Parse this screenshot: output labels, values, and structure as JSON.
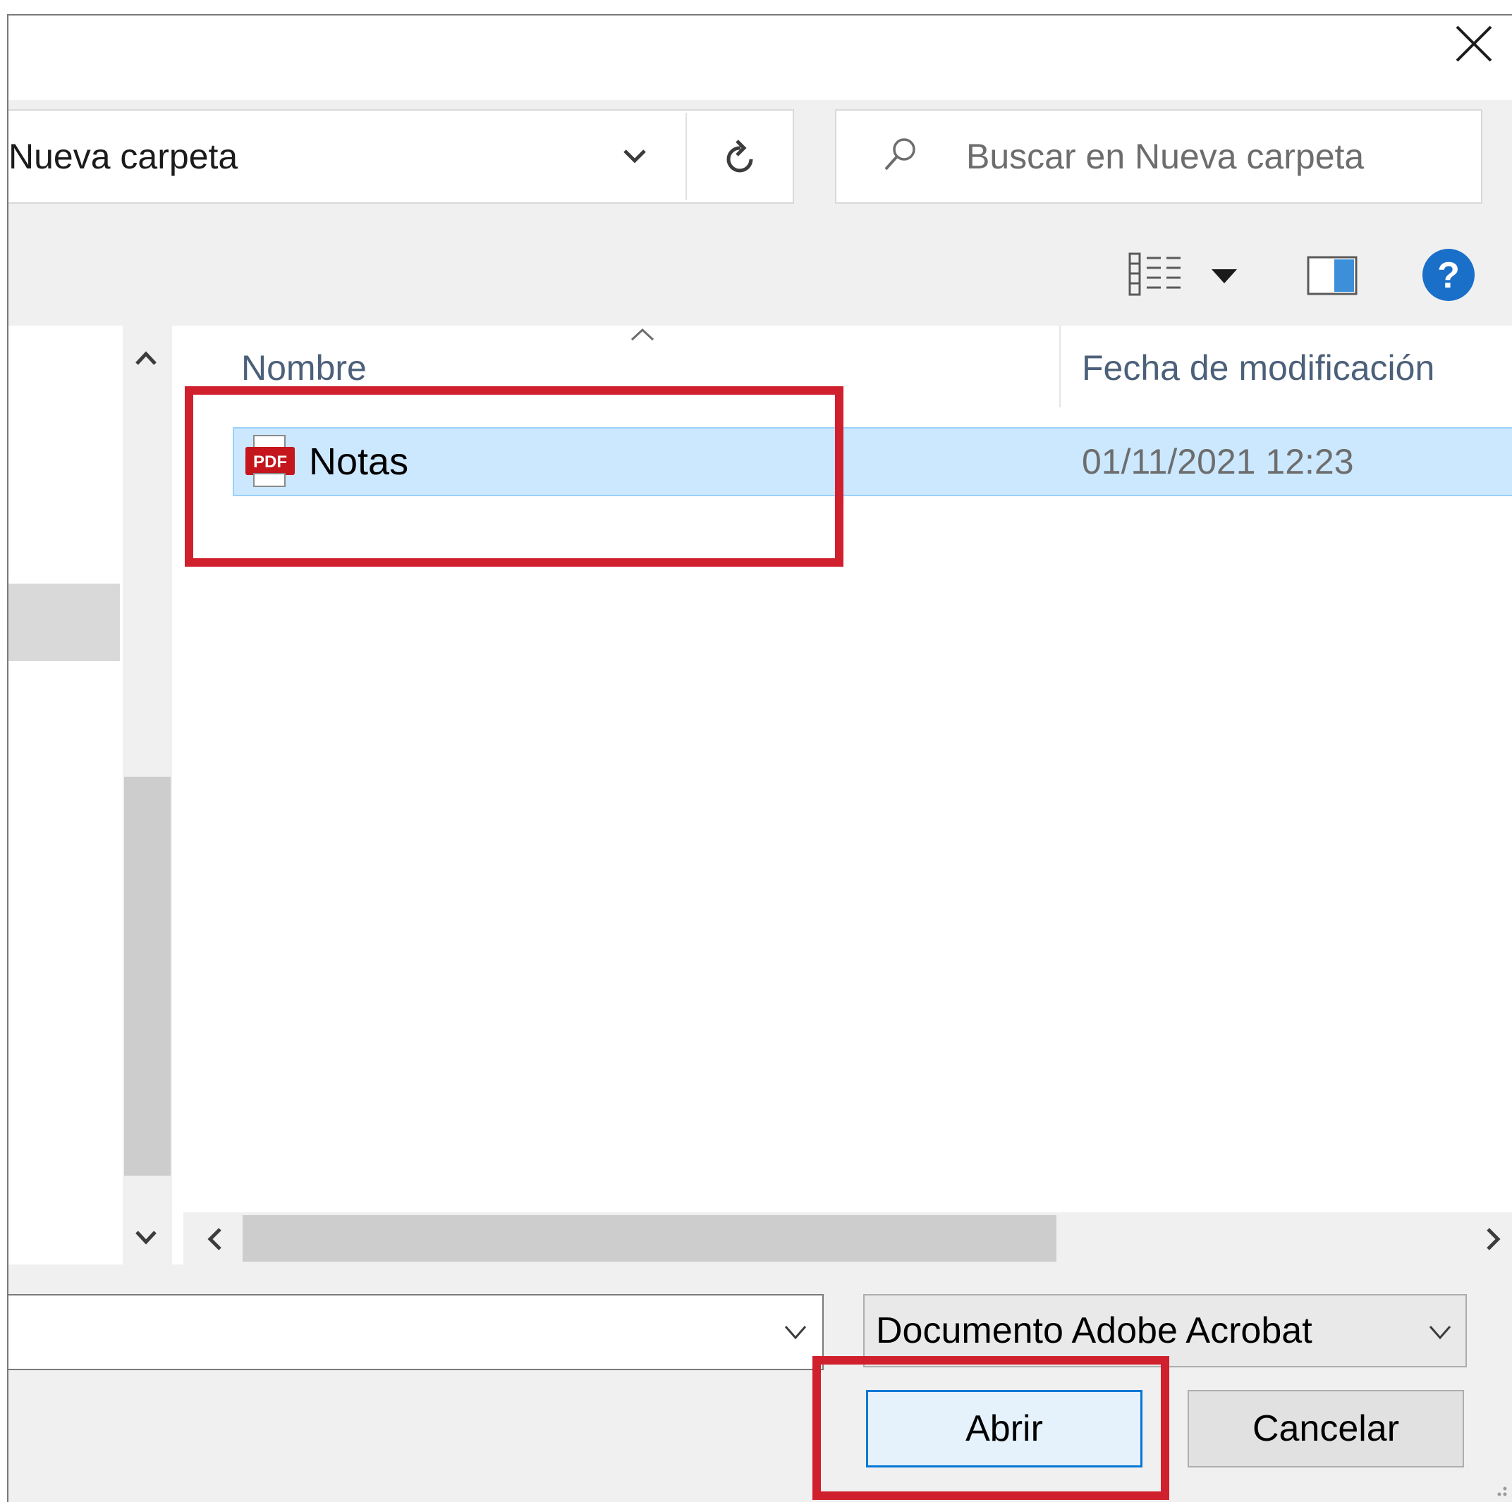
{
  "address": {
    "path": "Nueva carpeta",
    "dropdown_icon": "chevron-down-icon",
    "refresh_icon": "refresh-icon"
  },
  "search": {
    "placeholder": "Buscar en Nueva carpeta"
  },
  "toolbar": {
    "view_icon": "details-view-icon",
    "view_menu_icon": "dropdown-arrow-icon",
    "preview_icon": "preview-pane-icon",
    "help_icon": "help-icon"
  },
  "columns": {
    "name": "Nombre",
    "date": "Fecha de modificación"
  },
  "files": [
    {
      "name": "Notas",
      "date": "01/11/2021 12:23",
      "icon": "pdf-icon",
      "icon_label": "PDF"
    }
  ],
  "bottom": {
    "filename_value": "",
    "filetype": "Documento Adobe Acrobat",
    "open_label": "Abrir",
    "cancel_label": "Cancelar"
  },
  "colors": {
    "selection": "#cce8ff",
    "selection_border": "#99d1ff",
    "accent": "#0078d7",
    "highlight": "#d0202e",
    "pdf_red": "#c4161c",
    "help_blue": "#1a6fc9"
  }
}
